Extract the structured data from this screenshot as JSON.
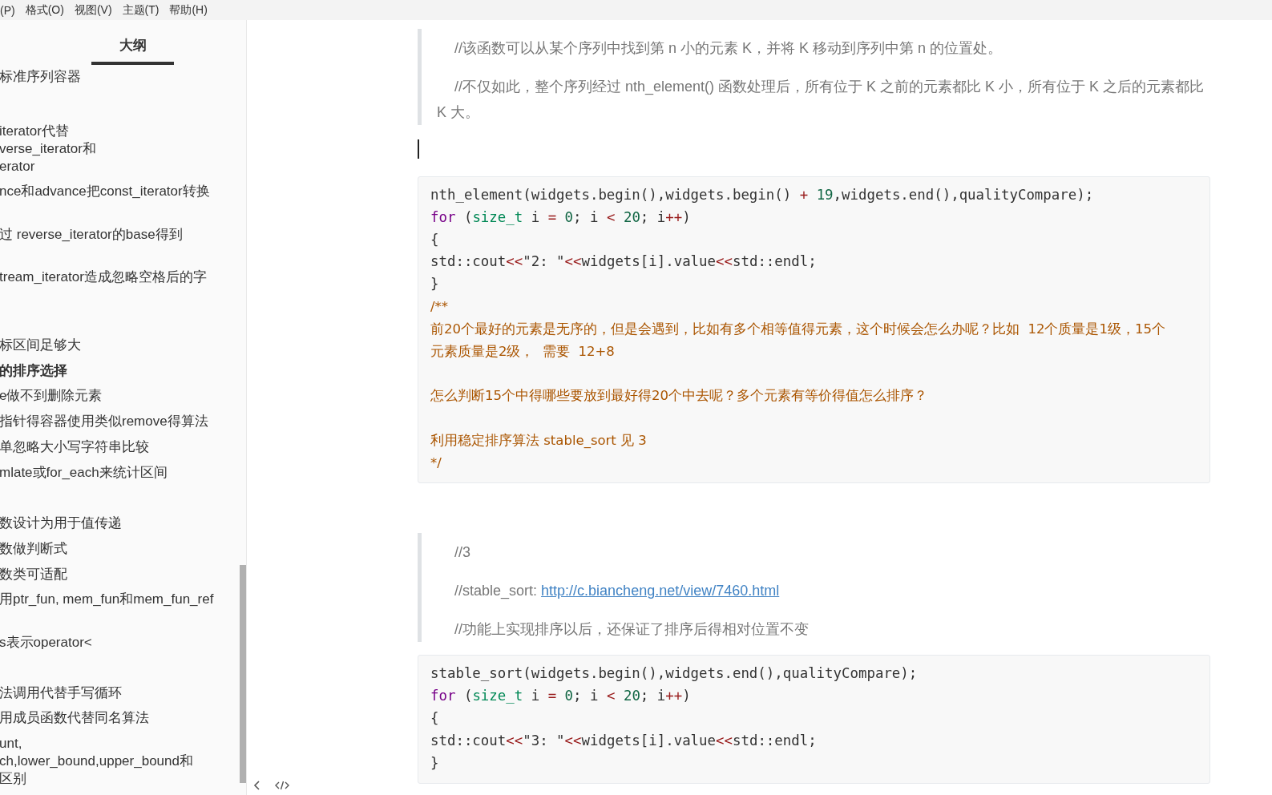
{
  "menu": [
    "(P)",
    "格式(O)",
    "视图(V)",
    "主题(T)",
    "帮助(H)"
  ],
  "sidebar": {
    "tab": {
      "label": "大纲",
      "selected": true
    },
    "items": [
      {
        "lines": [
          "标准序列容器"
        ],
        "selected": false
      },
      {
        "lines": [
          "iterator代替",
          "verse_iterator和",
          "erator"
        ],
        "selected": false
      },
      {
        "lines": [
          "nce和advance把const_iterator转换"
        ],
        "selected": false
      },
      {
        "lines": [
          "过 reverse_iterator的base得到"
        ],
        "selected": false
      },
      {
        "lines": [
          "tream_iterator造成忽略空格后的字"
        ],
        "selected": false
      },
      {
        "lines": [
          "标区间足够大"
        ],
        "selected": false
      },
      {
        "lines": [
          "的排序选择"
        ],
        "selected": true
      },
      {
        "lines": [
          "e做不到删除元素"
        ],
        "selected": false
      },
      {
        "lines": [
          "指针得容器使用类似remove得算法"
        ],
        "selected": false
      },
      {
        "lines": [
          "单忽略大小写字符串比较"
        ],
        "selected": false
      },
      {
        "lines": [
          "mlate或for_each来统计区间"
        ],
        "selected": false
      },
      {
        "lines": [
          "数设计为用于值传递"
        ],
        "selected": false
      },
      {
        "lines": [
          "数做判断式"
        ],
        "selected": false
      },
      {
        "lines": [
          "数类可适配"
        ],
        "selected": false
      },
      {
        "lines": [
          "用ptr_fun, mem_fun和mem_fun_ref"
        ],
        "selected": false
      },
      {
        "lines": [
          "s表示operator<"
        ],
        "selected": false
      },
      {
        "lines": [
          "法调用代替手写循环"
        ],
        "selected": false
      },
      {
        "lines": [
          "用成员函数代替同名算法"
        ],
        "selected": false
      },
      {
        "lines": [
          "unt,",
          "ch,lower_bound,upper_bound和",
          "区别"
        ],
        "selected": false
      }
    ]
  },
  "document": [
    {
      "kind": "quote",
      "paragraphs": [
        [
          {
            "text": "//该函数可以从某个序列中找到第 n 小的元素 K，并将 K 移动到序列中第 n 的位置处。"
          }
        ],
        [
          {
            "text": "//不仅如此，整个序列经过 nth_element() 函数处理后，所有位于 K 之前的元素都比 K 小，所有位于 K 之后的元素都比 K 大。"
          }
        ]
      ]
    },
    {
      "kind": "cursor"
    },
    {
      "kind": "code",
      "lines": [
        {
          "kind": "text",
          "tokens": [
            {
              "kind": "plain",
              "text": "nth_element(widgets.begin(),widgets.begin() "
            },
            {
              "kind": "op",
              "text": "+"
            },
            {
              "kind": "number",
              "text": " 19"
            },
            {
              "kind": "plain",
              "text": ",widgets.end(),qualityCompare);"
            }
          ]
        },
        {
          "kind": "text",
          "tokens": [
            {
              "kind": "keyword",
              "text": "for"
            },
            {
              "kind": "plain",
              "text": " ("
            },
            {
              "kind": "type",
              "text": "size_t"
            },
            {
              "kind": "plain",
              "text": " i "
            },
            {
              "kind": "op",
              "text": "="
            },
            {
              "kind": "number",
              "text": " 0"
            },
            {
              "kind": "plain",
              "text": "; i "
            },
            {
              "kind": "op",
              "text": "<"
            },
            {
              "kind": "number",
              "text": " 20"
            },
            {
              "kind": "plain",
              "text": "; i"
            },
            {
              "kind": "op",
              "text": "++"
            },
            {
              "kind": "plain",
              "text": ")"
            }
          ]
        },
        {
          "kind": "text",
          "tokens": [
            {
              "kind": "plain",
              "text": "{"
            }
          ]
        },
        {
          "kind": "text",
          "tokens": [
            {
              "kind": "plain",
              "text": "std::cout"
            },
            {
              "kind": "op",
              "text": "<<"
            },
            {
              "kind": "plain",
              "text": "\"2: \""
            },
            {
              "kind": "op",
              "text": "<<"
            },
            {
              "kind": "plain",
              "text": "widgets[i].value"
            },
            {
              "kind": "op",
              "text": "<<"
            },
            {
              "kind": "plain",
              "text": "std::endl;"
            }
          ]
        },
        {
          "kind": "text",
          "tokens": [
            {
              "kind": "plain",
              "text": "}"
            }
          ]
        },
        {
          "kind": "text",
          "tokens": [
            {
              "kind": "comment",
              "text": "/**"
            }
          ]
        },
        {
          "kind": "text",
          "tokens": [
            {
              "kind": "comment",
              "text": "前20个最好的元素是无序的，但是会遇到，比如有多个相等值得元素，这个时候会怎么办呢？比如  12个质量是1级，15个"
            }
          ]
        },
        {
          "kind": "text",
          "tokens": [
            {
              "kind": "comment",
              "text": "元素质量是2级，  需要  12+8"
            }
          ]
        },
        {
          "kind": "blank"
        },
        {
          "kind": "text",
          "tokens": [
            {
              "kind": "comment",
              "text": "怎么判断15个中得哪些要放到最好得20个中去呢？多个元素有等价得值怎么排序？"
            }
          ]
        },
        {
          "kind": "blank"
        },
        {
          "kind": "text",
          "tokens": [
            {
              "kind": "comment",
              "text": "利用稳定排序算法 stable_sort 见 3"
            }
          ]
        },
        {
          "kind": "text",
          "tokens": [
            {
              "kind": "comment",
              "text": "*/"
            }
          ]
        }
      ]
    },
    {
      "kind": "quote",
      "paragraphs": [
        [
          {
            "text": "//3"
          }
        ],
        [
          {
            "text": "//stable_sort: "
          },
          {
            "text": "http://c.biancheng.net/view/7460.html",
            "link": true
          }
        ],
        [
          {
            "text": "//功能上实现排序以后，还保证了排序后得相对位置不变"
          }
        ]
      ]
    },
    {
      "kind": "code",
      "lines": [
        {
          "kind": "text",
          "tokens": [
            {
              "kind": "plain",
              "text": "stable_sort(widgets.begin(),widgets.end(),qualityCompare);"
            }
          ]
        },
        {
          "kind": "text",
          "tokens": [
            {
              "kind": "keyword",
              "text": "for"
            },
            {
              "kind": "plain",
              "text": " ("
            },
            {
              "kind": "type",
              "text": "size_t"
            },
            {
              "kind": "plain",
              "text": " i "
            },
            {
              "kind": "op",
              "text": "="
            },
            {
              "kind": "number",
              "text": " 0"
            },
            {
              "kind": "plain",
              "text": "; i "
            },
            {
              "kind": "op",
              "text": "<"
            },
            {
              "kind": "number",
              "text": " 20"
            },
            {
              "kind": "plain",
              "text": "; i"
            },
            {
              "kind": "op",
              "text": "++"
            },
            {
              "kind": "plain",
              "text": ")"
            }
          ]
        },
        {
          "kind": "text",
          "tokens": [
            {
              "kind": "plain",
              "text": "{"
            }
          ]
        },
        {
          "kind": "text",
          "tokens": [
            {
              "kind": "plain",
              "text": "std::cout"
            },
            {
              "kind": "op",
              "text": "<<"
            },
            {
              "kind": "plain",
              "text": "\"3: \""
            },
            {
              "kind": "op",
              "text": "<<"
            },
            {
              "kind": "plain",
              "text": "widgets[i].value"
            },
            {
              "kind": "op",
              "text": "<<"
            },
            {
              "kind": "plain",
              "text": "std::endl;"
            }
          ]
        },
        {
          "kind": "text",
          "tokens": [
            {
              "kind": "plain",
              "text": "}"
            }
          ]
        }
      ]
    }
  ]
}
